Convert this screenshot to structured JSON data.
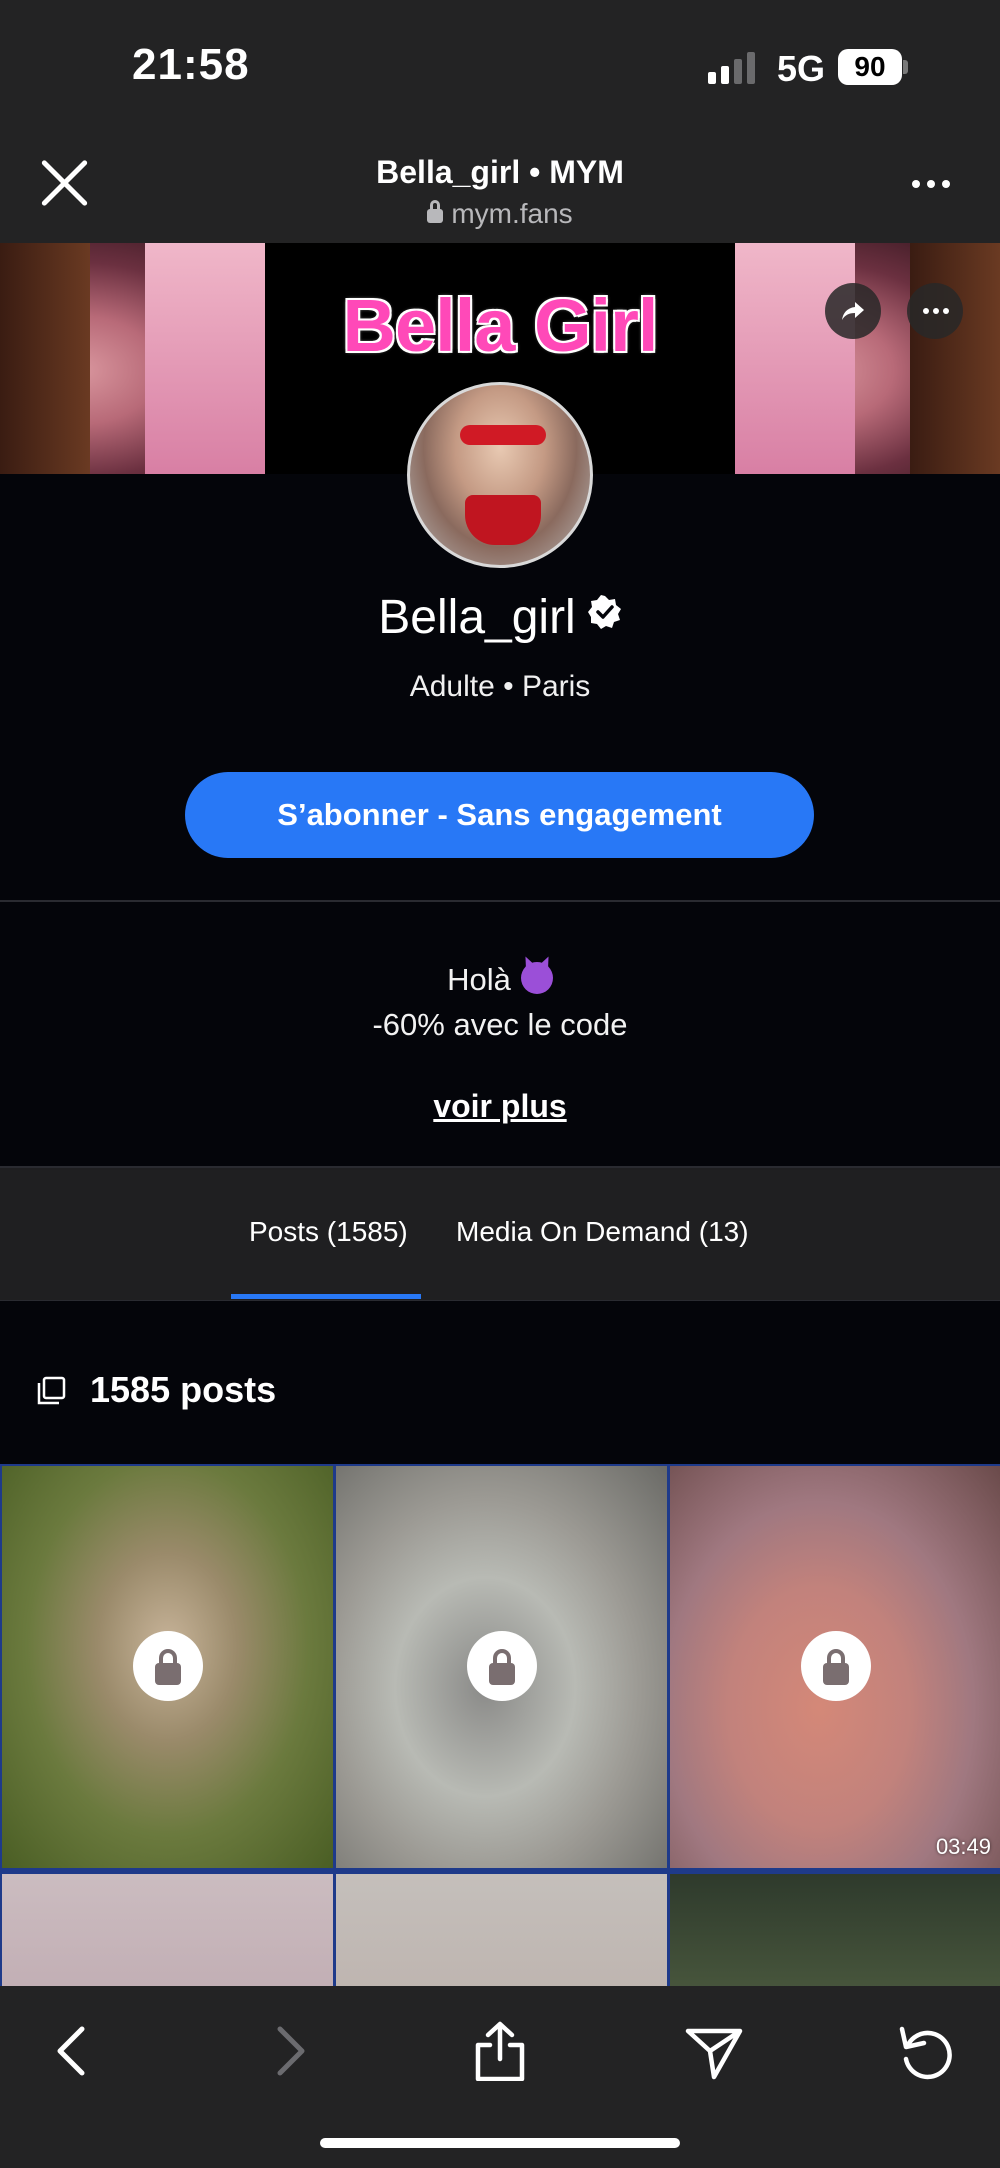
{
  "status_bar": {
    "time": "21:58",
    "network": "5G",
    "battery": "90"
  },
  "browser": {
    "title": "Bella_girl • MYM",
    "url": "mym.fans"
  },
  "banner": {
    "title": "Bella Girl"
  },
  "profile": {
    "name": "Bella_girl",
    "subtitle": "Adulte • Paris",
    "subscribe_label": "S’abonner - Sans engagement",
    "bio_line1": "Holà",
    "bio_line2": "-60% avec le code",
    "see_more": "voir plus"
  },
  "tabs": [
    {
      "label": "Posts (1585)",
      "active": true
    },
    {
      "label": "Media On Demand (13)",
      "active": false
    }
  ],
  "posts_count": "1585 posts",
  "grid": {
    "items": [
      {
        "locked": true,
        "duration": ""
      },
      {
        "locked": true,
        "duration": ""
      },
      {
        "locked": true,
        "duration": "03:49"
      },
      {
        "locked": false,
        "duration": ""
      },
      {
        "locked": false,
        "duration": ""
      },
      {
        "locked": false,
        "duration": ""
      }
    ]
  },
  "colors": {
    "accent": "#2878f6",
    "background": "#04050a",
    "chrome": "#232324",
    "banner_title": "#ff49b8"
  },
  "icons": [
    "close-icon",
    "lock-icon",
    "more-icon",
    "share-icon",
    "verified-icon",
    "devil-emoji-icon",
    "posts-stack-icon",
    "back-icon",
    "forward-icon",
    "upload-icon",
    "send-icon",
    "reload-icon"
  ]
}
